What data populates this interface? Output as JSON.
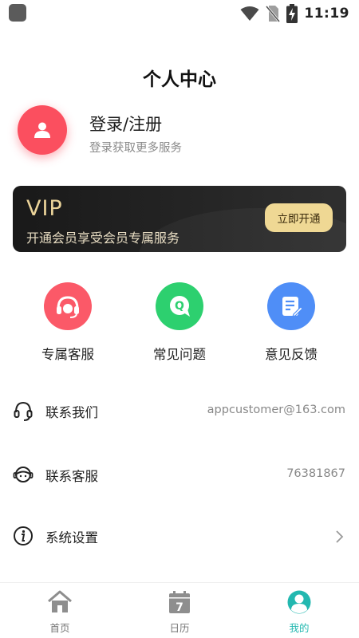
{
  "status_bar": {
    "time": "11:19"
  },
  "header": {
    "title": "个人中心"
  },
  "profile": {
    "title": "登录/注册",
    "subtitle": "登录获取更多服务"
  },
  "vip": {
    "title": "VIP",
    "subtitle": "开通会员享受会员专属服务",
    "button_label": "立即开通"
  },
  "quick_actions": [
    {
      "label": "专属客服",
      "icon": "headset-icon",
      "color": "#fb5968"
    },
    {
      "label": "常见问题",
      "icon": "question-bubble-icon",
      "color": "#2dd06f"
    },
    {
      "label": "意见反馈",
      "icon": "feedback-edit-icon",
      "color": "#4f8ef7"
    }
  ],
  "rows": [
    {
      "label": "联系我们",
      "value": "appcustomer@163.com",
      "icon": "headphones-icon"
    },
    {
      "label": "联系客服",
      "value": "76381867",
      "icon": "service-agent-icon"
    },
    {
      "label": "系统设置",
      "value": "",
      "icon": "info-icon"
    }
  ],
  "tabs": [
    {
      "label": "首页",
      "icon": "home-icon"
    },
    {
      "label": "日历",
      "icon": "calendar-icon",
      "badge": "7"
    },
    {
      "label": "我的",
      "icon": "profile-icon",
      "active": true
    }
  ],
  "colors": {
    "accent": "#23b8b0",
    "avatar": "#fb4f5f",
    "vip_gold": "#efd894"
  }
}
